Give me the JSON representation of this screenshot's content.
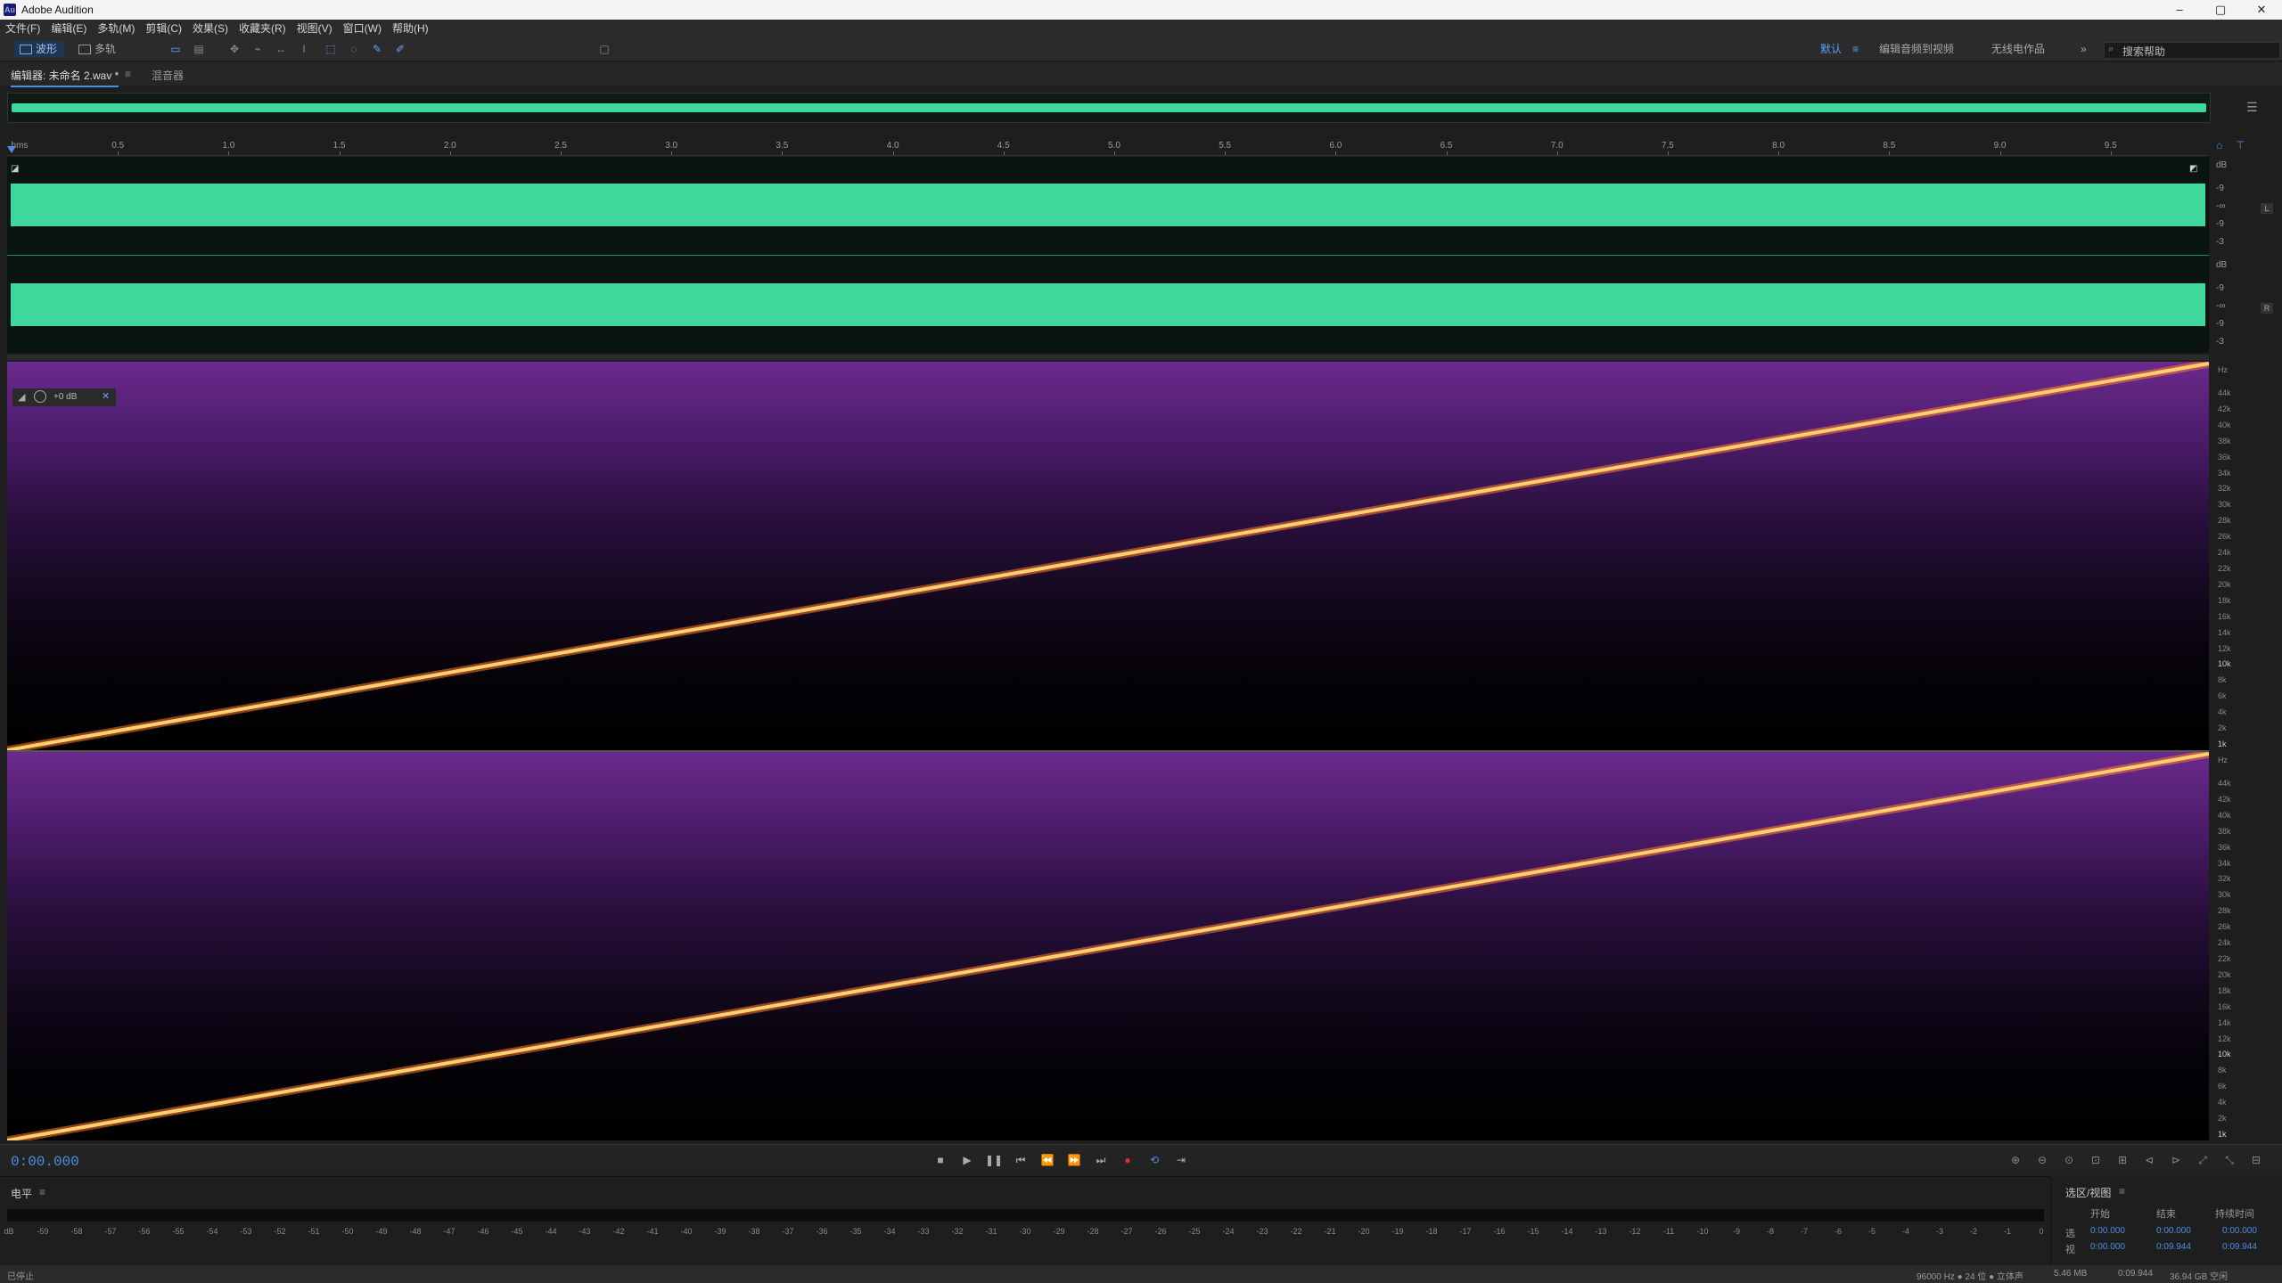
{
  "window": {
    "title": "Adobe Audition",
    "icon_text": "Au",
    "controls": [
      "–",
      "▢",
      "✕"
    ]
  },
  "menu": [
    "文件(F)",
    "编辑(E)",
    "多轨(M)",
    "剪辑(C)",
    "效果(S)",
    "收藏夹(R)",
    "视图(V)",
    "窗口(W)",
    "帮助(H)"
  ],
  "toolbar": {
    "waveform_label": "波形",
    "multitrack_label": "多轨",
    "workspaces": [
      "默认",
      "编辑音频到视频",
      "无线电作品"
    ],
    "more": "»",
    "search_placeholder": "搜索帮助"
  },
  "editor_tab": {
    "label": "编辑器: 未命名 2.wav *",
    "menu": "≡",
    "mixer_label": "混音器"
  },
  "ruler": {
    "start_label": "hms",
    "labels": [
      "0.5",
      "1.0",
      "1.5",
      "2.0",
      "2.5",
      "3.0",
      "3.5",
      "4.0",
      "4.5",
      "5.0",
      "5.5",
      "6.0",
      "6.5",
      "7.0",
      "7.5",
      "8.0",
      "8.5",
      "9.0",
      "9.5"
    ]
  },
  "amp_axis": {
    "unit": "dB",
    "ticks": [
      "-9",
      "-∞",
      "-9",
      "-3"
    ],
    "left_tag": "L",
    "right_tag": "R"
  },
  "spectral_hud": {
    "gain": "+0 dB"
  },
  "hz_axis": {
    "unit": "Hz",
    "ticks": [
      "44k",
      "42k",
      "40k",
      "38k",
      "36k",
      "34k",
      "32k",
      "30k",
      "28k",
      "26k",
      "24k",
      "22k",
      "20k",
      "18k",
      "16k",
      "14k",
      "12k",
      "10k",
      "8k",
      "6k",
      "4k",
      "2k",
      "1k"
    ]
  },
  "transport": {
    "timecode": "0:00.000"
  },
  "level_panel": {
    "title": "电平",
    "menu": "≡",
    "db_scale": [
      "dB",
      "-59",
      "-58",
      "-57",
      "-56",
      "-55",
      "-54",
      "-53",
      "-52",
      "-51",
      "-50",
      "-49",
      "-48",
      "-47",
      "-46",
      "-45",
      "-44",
      "-43",
      "-42",
      "-41",
      "-40",
      "-39",
      "-38",
      "-37",
      "-36",
      "-35",
      "-34",
      "-33",
      "-32",
      "-31",
      "-30",
      "-29",
      "-28",
      "-27",
      "-26",
      "-25",
      "-24",
      "-23",
      "-22",
      "-21",
      "-20",
      "-19",
      "-18",
      "-17",
      "-16",
      "-15",
      "-14",
      "-13",
      "-12",
      "-11",
      "-10",
      "-9",
      "-8",
      "-7",
      "-6",
      "-5",
      "-4",
      "-3",
      "-2",
      "-1",
      "0"
    ]
  },
  "selection_panel": {
    "title": "选区/视图",
    "menu": "≡",
    "headers": [
      "开始",
      "结束",
      "持续时间"
    ],
    "rows": [
      {
        "label": "选",
        "start": "0:00.000",
        "end": "0:00.000",
        "duration": "0:00.000"
      },
      {
        "label": "视",
        "start": "0:00.000",
        "end": "0:09.944",
        "duration": "0:09.944"
      }
    ]
  },
  "status": {
    "state": "已停止",
    "format": "96000 Hz ● 24 位 ● 立体声",
    "size": "5.46 MB",
    "duration": "0:09.944",
    "free": "36.94 GB 空闲"
  },
  "colors": {
    "waveform": "#3fd89c",
    "accent": "#4a90e2",
    "sweep": "#ffd070"
  }
}
